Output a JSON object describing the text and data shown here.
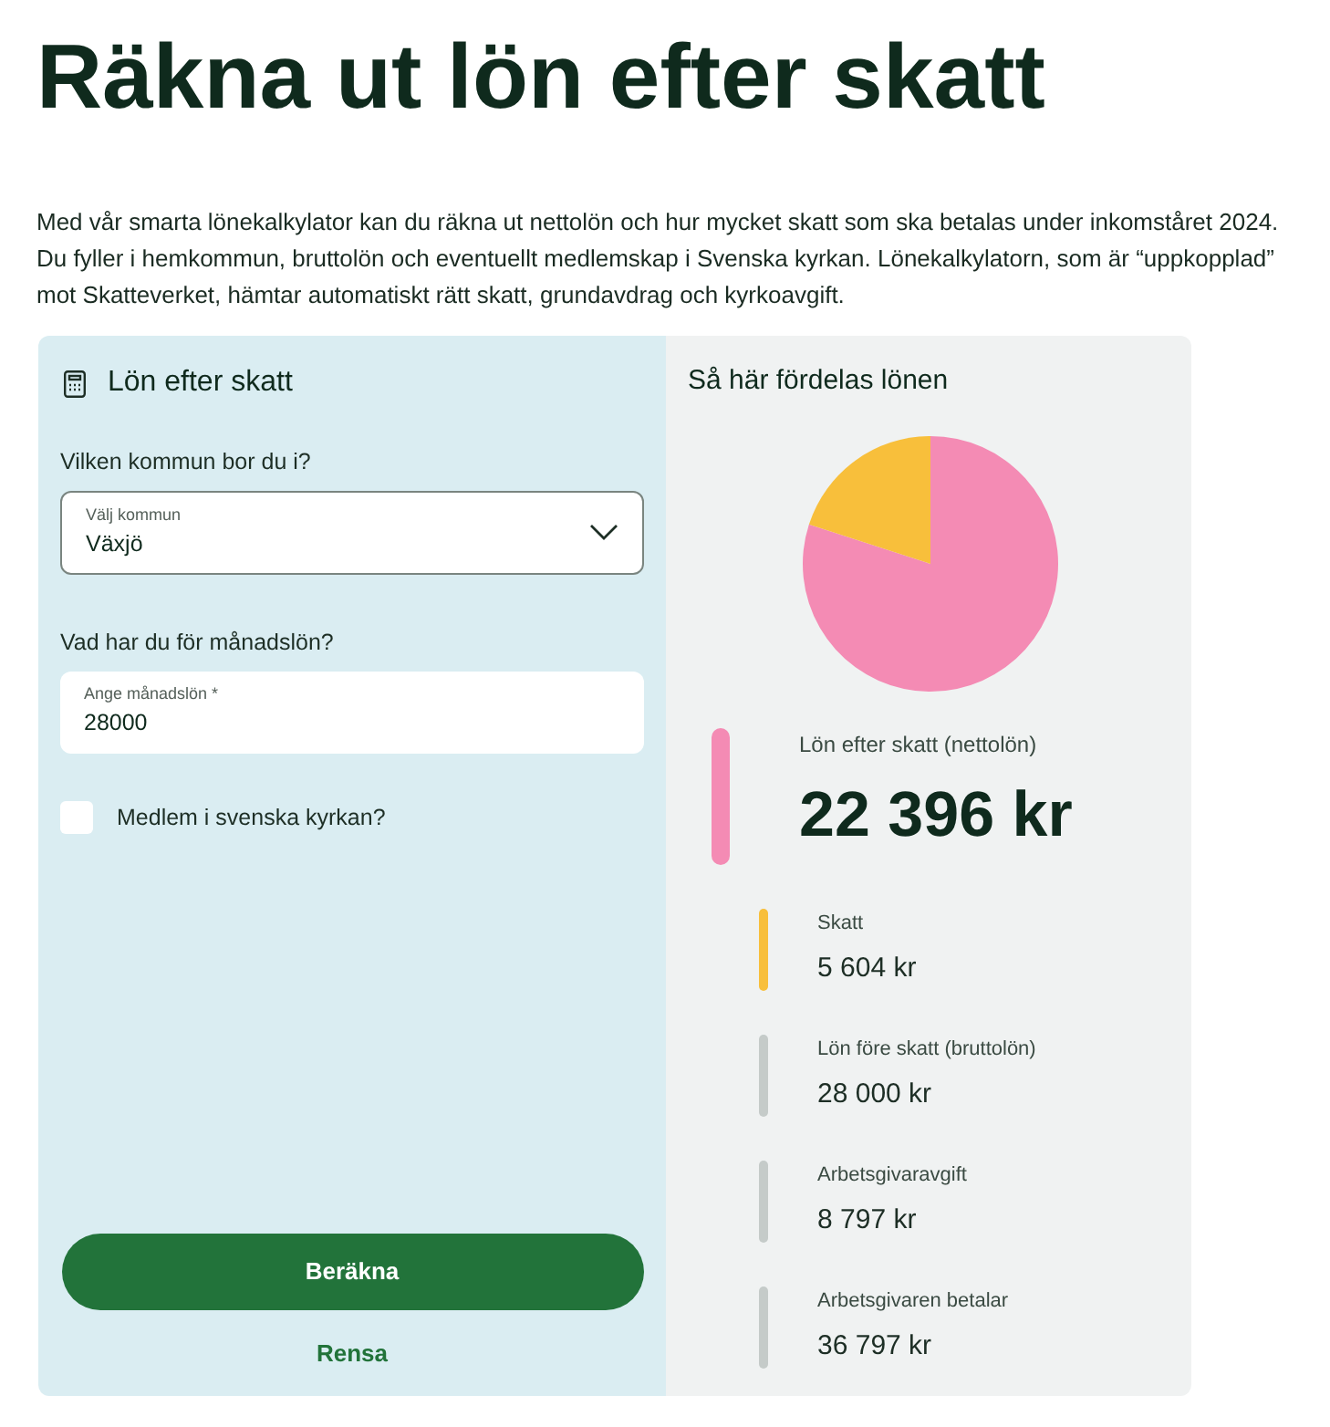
{
  "title": "Räkna ut lön efter skatt",
  "intro": "Med vår smarta lönekalkylator kan du räkna ut nettolön och hur mycket skatt som ska betalas under inkomståret 2024. Du fyller i hemkommun, bruttolön och eventuellt medlemskap i Svenska kyrkan. Lönekalkylatorn, som är “uppkopplad” mot Skatteverket, hämtar automatiskt rätt skatt, grundavdrag och kyrkoavgift.",
  "calculator": {
    "title": "Lön efter skatt",
    "municipality": {
      "question": "Vilken kommun bor du i?",
      "label": "Välj kommun",
      "value": "Växjö"
    },
    "salary": {
      "question": "Vad har du för månadslön?",
      "label": "Ange månadslön *",
      "value": "28000"
    },
    "church": {
      "label": "Medlem i svenska kyrkan?",
      "checked": false
    },
    "buttons": [
      {
        "kind": "primary",
        "label": "Beräkna"
      },
      {
        "kind": "link",
        "label": "Rensa"
      }
    ]
  },
  "result": {
    "title": "Så här fördelas lönen",
    "items": [
      {
        "kind": "main",
        "label": "Lön efter skatt (nettolön)",
        "value": "22 396 kr",
        "color": "#f48bb4"
      },
      {
        "kind": "detail",
        "label": "Skatt",
        "value": "5 604 kr",
        "color": "#f8bf3b"
      },
      {
        "kind": "detail",
        "label": "Lön före skatt (bruttolön)",
        "value": "28 000 kr",
        "color": "#c5cbc9"
      },
      {
        "kind": "detail",
        "label": "Arbetsgivaravgift",
        "value": "8 797 kr",
        "color": "#c5cbc9"
      },
      {
        "kind": "detail",
        "label": "Arbetsgivaren betalar",
        "value": "36 797 kr",
        "color": "#c5cbc9"
      }
    ]
  }
}
